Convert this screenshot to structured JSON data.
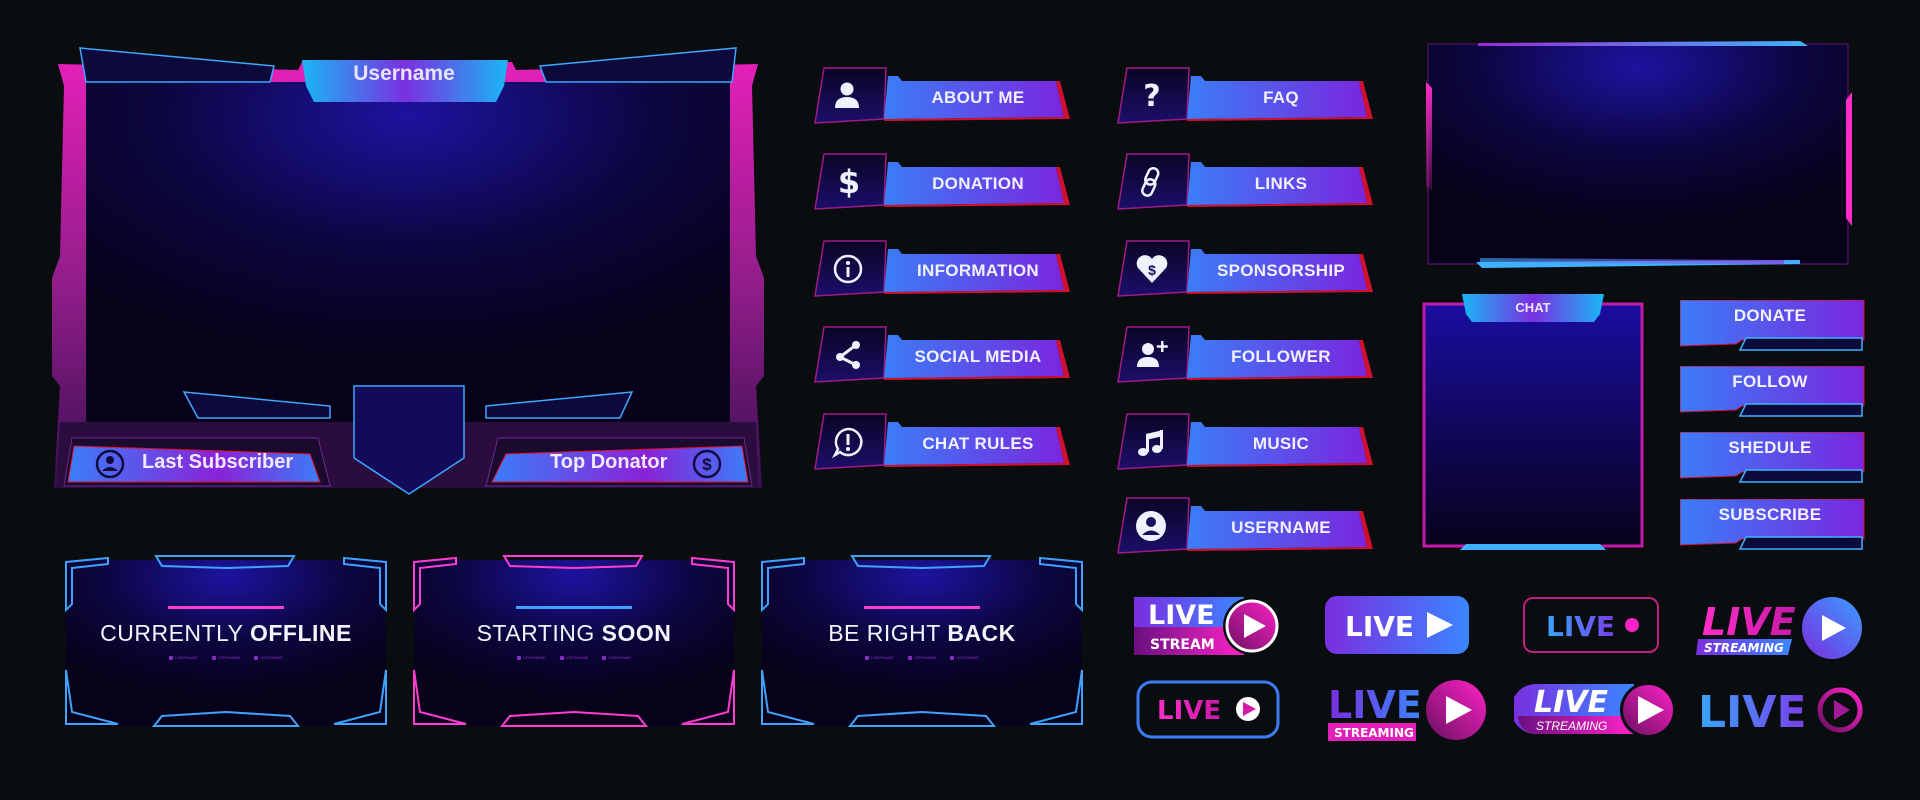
{
  "theme": {
    "background": "#0a0d10",
    "blue": "#3b82f6",
    "cyan": "#19b6f5",
    "purple": "#7b2ee0",
    "magenta": "#e21fb8",
    "red_edge": "#d0102e",
    "navy": "#140a5a",
    "deep": "#07021a"
  },
  "webcam_frame": {
    "username_tab": "Username",
    "left_label": "Last Subscriber",
    "left_icon": "user-circle-icon",
    "right_label": "Top Donator",
    "right_icon": "dollar-circle-icon"
  },
  "panels": {
    "column1": [
      {
        "label": "ABOUT ME",
        "icon": "user-icon"
      },
      {
        "label": "DONATION",
        "icon": "dollar-icon"
      },
      {
        "label": "INFORMATION",
        "icon": "info-icon"
      },
      {
        "label": "SOCIAL MEDIA",
        "icon": "share-icon"
      },
      {
        "label": "CHAT RULES",
        "icon": "alert-chat-icon"
      }
    ],
    "column2": [
      {
        "label": "FAQ",
        "icon": "question-icon"
      },
      {
        "label": "LINKS",
        "icon": "link-icon"
      },
      {
        "label": "SPONSORSHIP",
        "icon": "heart-dollar-icon"
      },
      {
        "label": "FOLLOWER",
        "icon": "user-plus-icon"
      },
      {
        "label": "MUSIC",
        "icon": "music-icon"
      },
      {
        "label": "USERNAME",
        "icon": "user-circle-icon"
      }
    ]
  },
  "chat": {
    "title": "CHAT"
  },
  "side_buttons": [
    "DONATE",
    "FOLLOW",
    "SHEDULE",
    "SUBSCRIBE"
  ],
  "scenes": [
    {
      "light": "CURRENTLY",
      "bold": "OFFLINE",
      "frame_color": "#3fa2ff",
      "line_color": "#ff3dd0",
      "socials": [
        "USERNAME",
        "USERNAME",
        "USERNAME"
      ]
    },
    {
      "light": "STARTING",
      "bold": "SOON",
      "frame_color": "#ff3dd0",
      "line_color": "#3fa2ff",
      "socials": [
        "USERNAME",
        "USERNAME",
        "USERNAME"
      ]
    },
    {
      "light": "BE RIGHT",
      "bold": "BACK",
      "frame_color": "#3fa2ff",
      "line_color": "#ff3dd0",
      "socials": [
        "USERNAME",
        "USERNAME",
        "USERNAME"
      ]
    }
  ],
  "live_badges": {
    "b1": {
      "main": "LIVE",
      "sub": "STREAM"
    },
    "b2": {
      "main": "LIVE"
    },
    "b3": {
      "main": "LIVE"
    },
    "b4": {
      "main": "LIVE",
      "sub": "STREAMING"
    },
    "b5": {
      "main": "LIVE"
    },
    "b6": {
      "main": "LIVE",
      "sub": "STREAMING"
    },
    "b7": {
      "main": "LIVE",
      "sub": "STREAMING"
    },
    "b8": {
      "main": "LIVE"
    }
  }
}
